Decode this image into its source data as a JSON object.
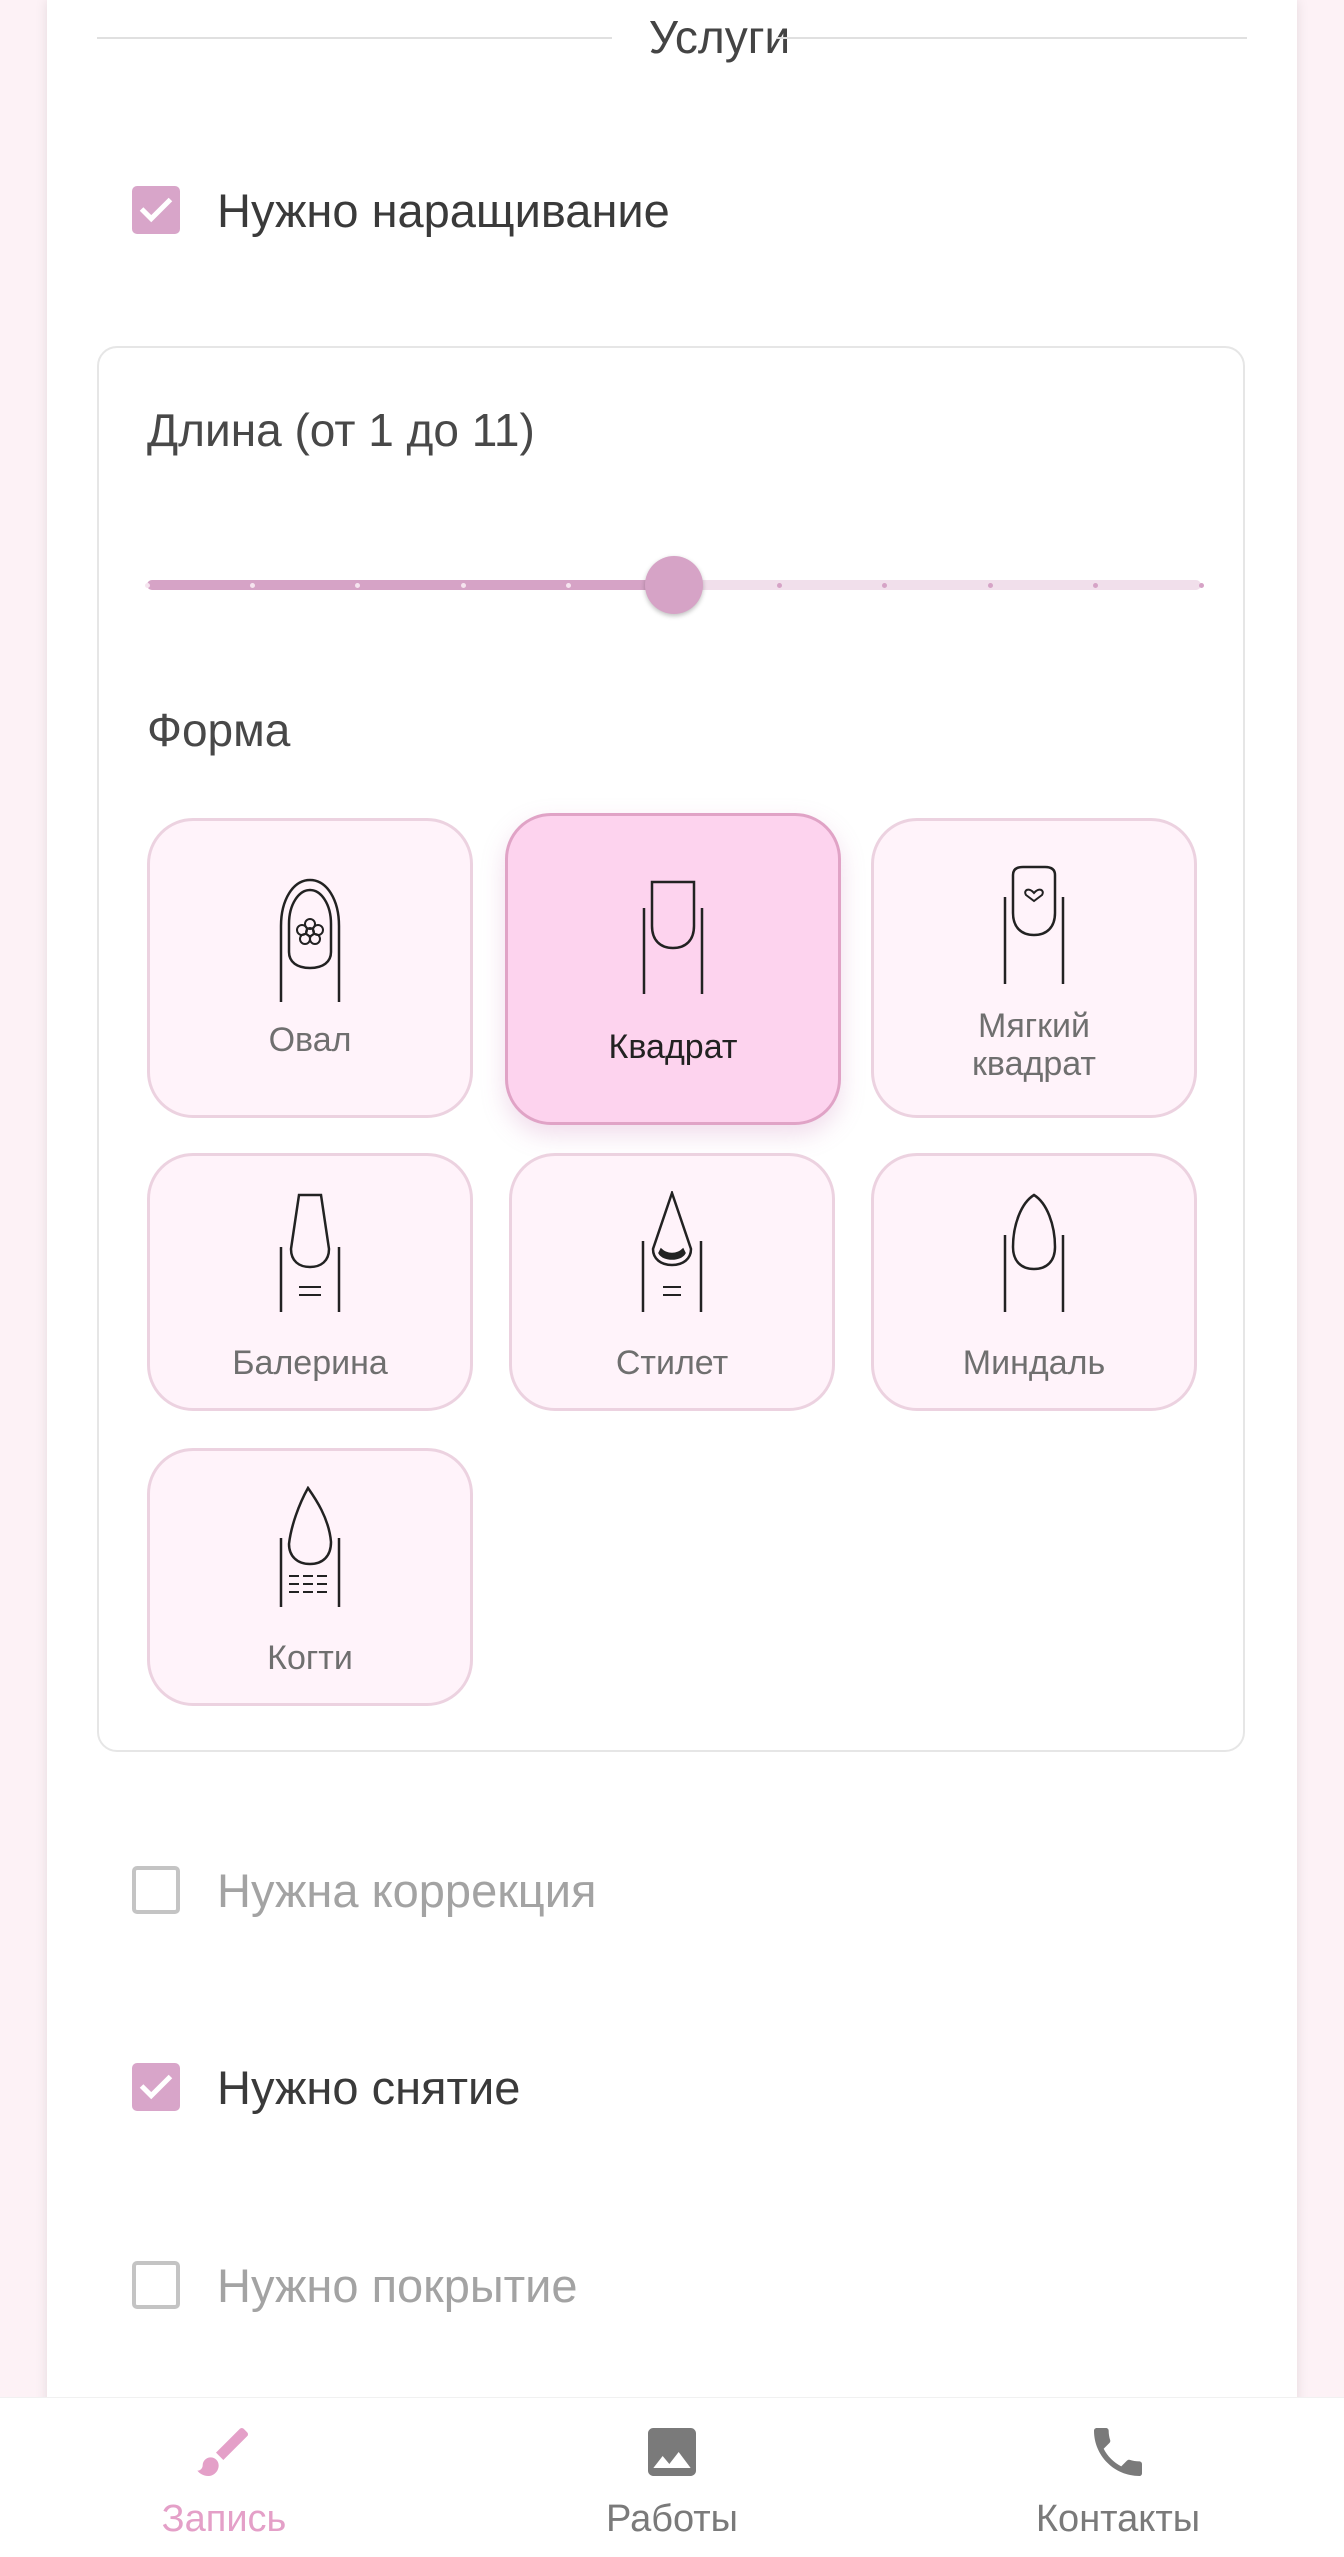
{
  "services": {
    "title": "Услуги",
    "extension_label": "Нужно наращивание",
    "extension_checked": true,
    "correction_label": "Нужна коррекция",
    "correction_checked": false,
    "removal_label": "Нужно снятие",
    "removal_checked": true,
    "coating_label": "Нужно покрытие",
    "coating_checked": false
  },
  "length": {
    "label": "Длина (от 1 до 11)",
    "min": 1,
    "max": 11,
    "value": 6
  },
  "shape": {
    "label": "Форма",
    "selected": "Квадрат",
    "options": [
      {
        "label": "Овал",
        "icon": "oval-nail-icon"
      },
      {
        "label": "Квадрат",
        "icon": "square-nail-icon"
      },
      {
        "label": "Мягкий квадрат",
        "icon": "soft-square-nail-icon"
      },
      {
        "label": "Балерина",
        "icon": "ballerina-nail-icon"
      },
      {
        "label": "Стилет",
        "icon": "stiletto-nail-icon"
      },
      {
        "label": "Миндаль",
        "icon": "almond-nail-icon"
      },
      {
        "label": "Когти",
        "icon": "claws-nail-icon"
      }
    ]
  },
  "nav": {
    "items": [
      {
        "label": "Запись",
        "icon": "brush-icon",
        "active": true
      },
      {
        "label": "Работы",
        "icon": "image-icon",
        "active": false
      },
      {
        "label": "Контакты",
        "icon": "phone-icon",
        "active": false
      }
    ]
  },
  "colors": {
    "accent": "#d6a3c6",
    "accent_text": "#e4a0c8",
    "selected_card": "#fdd3ee",
    "card_bg": "#fff3fa",
    "nav_inactive": "#7a7a7a"
  }
}
